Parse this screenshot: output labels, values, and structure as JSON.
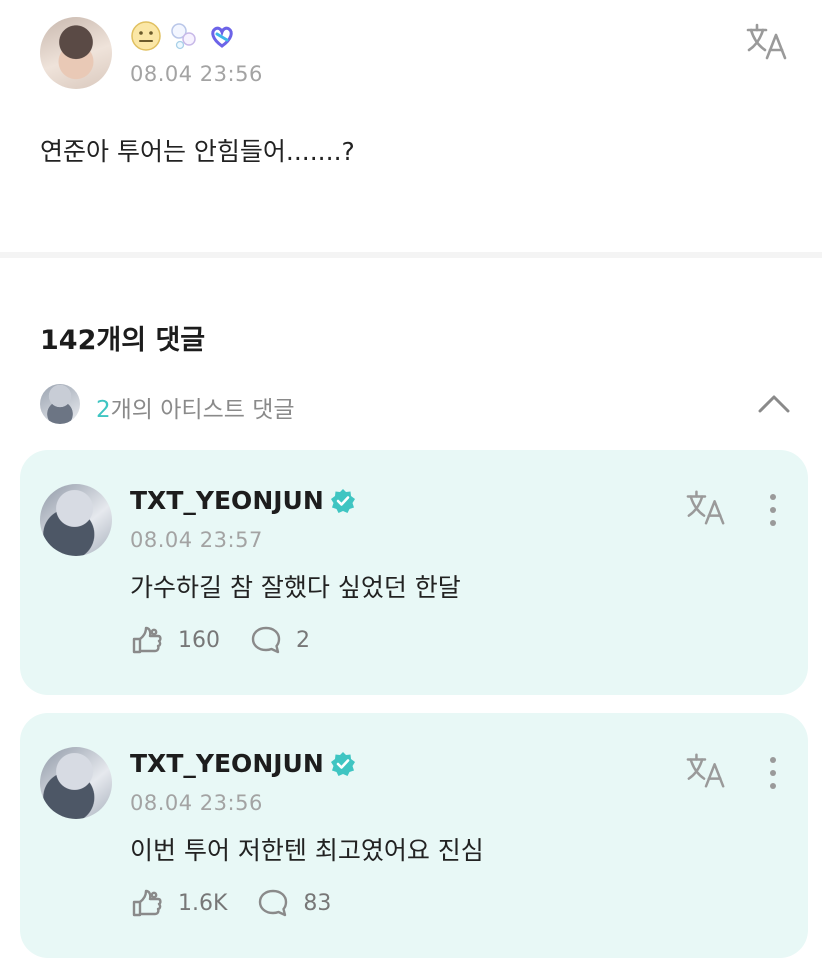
{
  "post": {
    "time": "08.04 23:56",
    "text": "연준아 투어는 안힘들어.......?",
    "badges": [
      "neutral-face-icon",
      "bubbles-icon",
      "heart-link-icon"
    ]
  },
  "comments_header": {
    "count_label": "142개의 댓글"
  },
  "artist_comments": {
    "count": "2",
    "label_suffix": "개의 아티스트 댓글"
  },
  "comments": [
    {
      "author": "TXT_YEONJUN",
      "time": "08.04 23:57",
      "text": "가수하길 참 잘했다 싶었던 한달",
      "likes": "160",
      "replies": "2"
    },
    {
      "author": "TXT_YEONJUN",
      "time": "08.04 23:56",
      "text": "이번 투어 저한텐 최고였어요 진심",
      "likes": "1.6K",
      "replies": "83"
    }
  ],
  "colors": {
    "accent": "#3fc5c2",
    "card_bg": "#e8f8f6",
    "muted_text": "#a3a3a3"
  }
}
